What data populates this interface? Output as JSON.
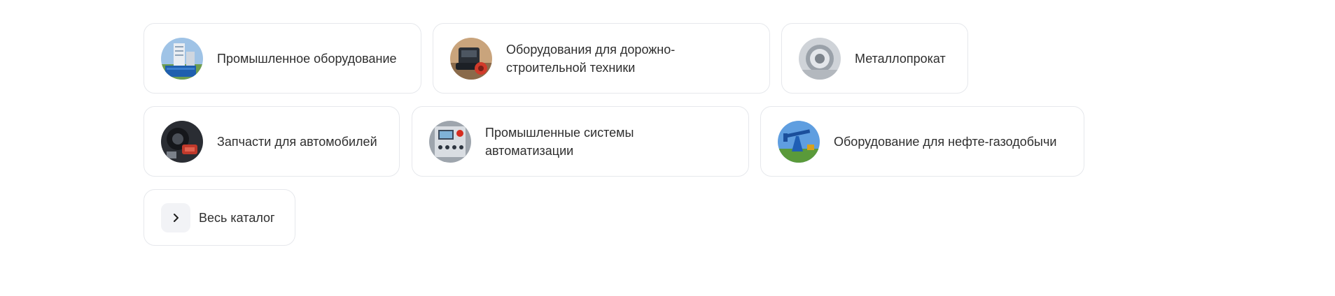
{
  "categories": [
    {
      "label": "Промышленное оборудование",
      "icon": "industrial-equipment-image"
    },
    {
      "label": "Оборудования для дорожно-строительной техники",
      "icon": "road-machinery-image"
    },
    {
      "label": "Металлопрокат",
      "icon": "rolled-metal-image"
    },
    {
      "label": "Запчасти для автомобилей",
      "icon": "car-parts-image"
    },
    {
      "label": "Промышленные системы автоматизации",
      "icon": "automation-panel-image"
    },
    {
      "label": "Оборудование для нефте-газодобычи",
      "icon": "oil-pump-image"
    }
  ],
  "catalog_link": {
    "label": "Весь каталог",
    "icon": "chevron-right-icon"
  }
}
